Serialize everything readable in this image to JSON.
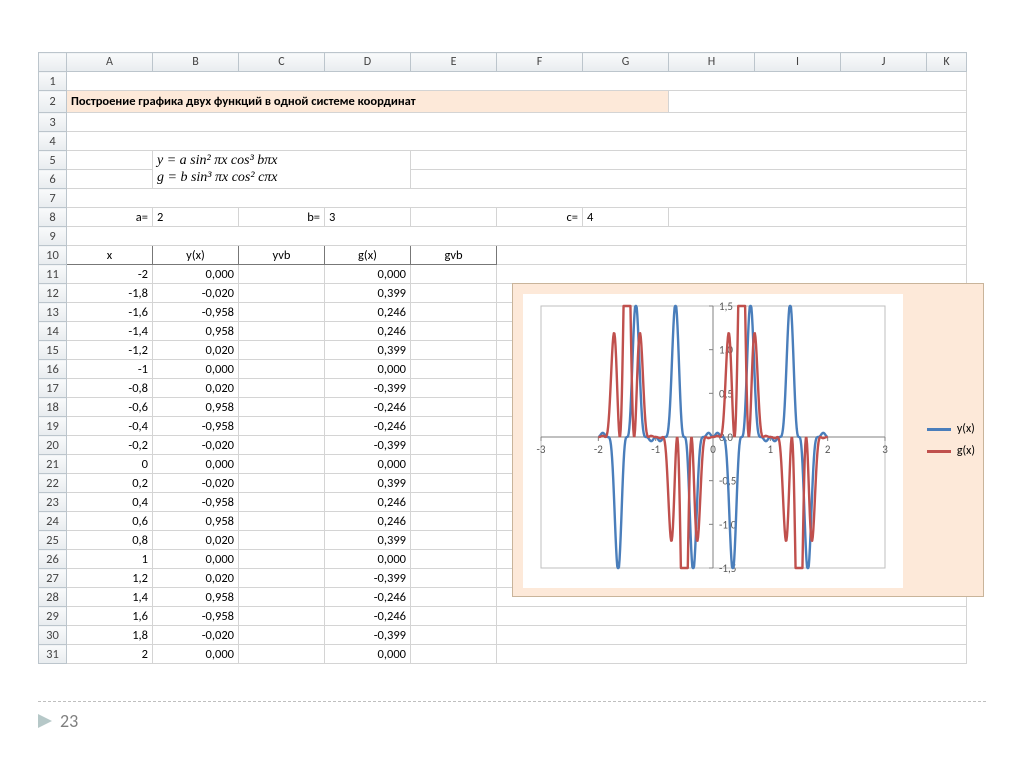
{
  "title": "Построение графика двух функций в одной системе координат",
  "formulas": {
    "line1": "y = a sin² πx cos³ bπx",
    "line2": "g = b sin³ πx cos² cπx"
  },
  "params": {
    "a_label": "a=",
    "a_val": "2",
    "b_label": "b=",
    "b_val": "3",
    "c_label": "c=",
    "c_val": "4"
  },
  "cols": [
    "A",
    "B",
    "C",
    "D",
    "E",
    "F",
    "G",
    "H",
    "I",
    "J",
    "K"
  ],
  "table_headers": {
    "x": "x",
    "y": "y(x)",
    "yvb": "yvb",
    "g": "g(x)",
    "gvb": "gvb"
  },
  "rows": [
    {
      "n": 11,
      "x": "-2",
      "y": "0,000",
      "g": "0,000"
    },
    {
      "n": 12,
      "x": "-1,8",
      "y": "-0,020",
      "g": "0,399"
    },
    {
      "n": 13,
      "x": "-1,6",
      "y": "-0,958",
      "g": "0,246"
    },
    {
      "n": 14,
      "x": "-1,4",
      "y": "0,958",
      "g": "0,246"
    },
    {
      "n": 15,
      "x": "-1,2",
      "y": "0,020",
      "g": "0,399"
    },
    {
      "n": 16,
      "x": "-1",
      "y": "0,000",
      "g": "0,000"
    },
    {
      "n": 17,
      "x": "-0,8",
      "y": "0,020",
      "g": "-0,399"
    },
    {
      "n": 18,
      "x": "-0,6",
      "y": "0,958",
      "g": "-0,246"
    },
    {
      "n": 19,
      "x": "-0,4",
      "y": "-0,958",
      "g": "-0,246"
    },
    {
      "n": 20,
      "x": "-0,2",
      "y": "-0,020",
      "g": "-0,399"
    },
    {
      "n": 21,
      "x": "0",
      "y": "0,000",
      "g": "0,000"
    },
    {
      "n": 22,
      "x": "0,2",
      "y": "-0,020",
      "g": "0,399"
    },
    {
      "n": 23,
      "x": "0,4",
      "y": "-0,958",
      "g": "0,246"
    },
    {
      "n": 24,
      "x": "0,6",
      "y": "0,958",
      "g": "0,246"
    },
    {
      "n": 25,
      "x": "0,8",
      "y": "0,020",
      "g": "0,399"
    },
    {
      "n": 26,
      "x": "1",
      "y": "0,000",
      "g": "0,000"
    },
    {
      "n": 27,
      "x": "1,2",
      "y": "0,020",
      "g": "-0,399"
    },
    {
      "n": 28,
      "x": "1,4",
      "y": "0,958",
      "g": "-0,246"
    },
    {
      "n": 29,
      "x": "1,6",
      "y": "-0,958",
      "g": "-0,246"
    },
    {
      "n": 30,
      "x": "1,8",
      "y": "-0,020",
      "g": "-0,399"
    },
    {
      "n": 31,
      "x": "2",
      "y": "0,000",
      "g": "0,000"
    }
  ],
  "legend": {
    "y": "y(x)",
    "g": "g(x)"
  },
  "slide_number": "23",
  "chart_data": {
    "type": "line",
    "x": [
      -2,
      -1.8,
      -1.6,
      -1.4,
      -1.2,
      -1,
      -0.8,
      -0.6,
      -0.4,
      -0.2,
      0,
      0.2,
      0.4,
      0.6,
      0.8,
      1,
      1.2,
      1.4,
      1.6,
      1.8,
      2
    ],
    "series": [
      {
        "name": "y(x)",
        "color": "#4a7ebb",
        "values": [
          0,
          -0.02,
          -0.958,
          0.958,
          0.02,
          0,
          0.02,
          0.958,
          -0.958,
          -0.02,
          0,
          -0.02,
          -0.958,
          0.958,
          0.02,
          0,
          0.02,
          0.958,
          -0.958,
          -0.02,
          0
        ]
      },
      {
        "name": "g(x)",
        "color": "#c0504d",
        "values": [
          0,
          0.399,
          0.246,
          0.246,
          0.399,
          0,
          -0.399,
          -0.246,
          -0.246,
          -0.399,
          0,
          0.399,
          0.246,
          0.246,
          0.399,
          0,
          -0.399,
          -0.246,
          -0.246,
          -0.399,
          0
        ]
      }
    ],
    "xlim": [
      -3,
      3
    ],
    "ylim": [
      -1.5,
      1.5
    ],
    "xticks": [
      -3,
      -2,
      -1,
      0,
      1,
      2,
      3
    ],
    "yticks": [
      -1.5,
      -1,
      -0.5,
      0,
      0.5,
      1,
      1.5
    ],
    "ytick_labels": [
      "-1,5",
      "-1,0",
      "-0,5",
      "0,0",
      "0,5",
      "1,0",
      "1,5"
    ],
    "xlabel": "",
    "ylabel": "",
    "title": "",
    "grid": false
  }
}
